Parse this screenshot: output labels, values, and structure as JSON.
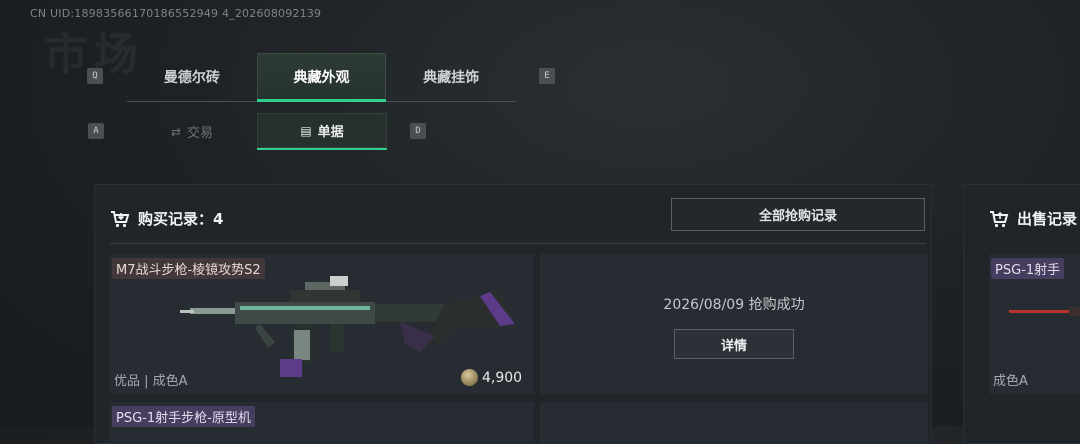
{
  "uid": "CN UID:18983566170186552949 4_202608092139",
  "watermark_title": "市场",
  "keys": {
    "left_tab": "Q",
    "right_tab": "E",
    "left_sub": "A",
    "right_sub": "D"
  },
  "top_tabs": [
    {
      "label": "曼德尔砖",
      "active": false
    },
    {
      "label": "典藏外观",
      "active": true
    },
    {
      "label": "典藏挂饰",
      "active": false
    }
  ],
  "sub_tabs": [
    {
      "label": "交易",
      "icon": "trade-icon",
      "active": false
    },
    {
      "label": "单据",
      "icon": "receipt-icon",
      "active": true
    }
  ],
  "purchase": {
    "title": "购买记录：4",
    "all_button": "全部抢购记录",
    "items": [
      {
        "name": "M7战斗步枪-棱镜攻势S2",
        "quality": "优品 | 成色A",
        "price": "4,900",
        "status": "2026/08/09 抢购成功",
        "detail_button": "详情"
      },
      {
        "name": "PSG-1射手步枪-原型机"
      }
    ]
  },
  "sell": {
    "title": "出售记录",
    "item_name": "PSG-1射手",
    "quality": "成色A"
  },
  "colors": {
    "accent": "#2fd18e",
    "background": "#1d2124",
    "panel": "#20252a"
  }
}
